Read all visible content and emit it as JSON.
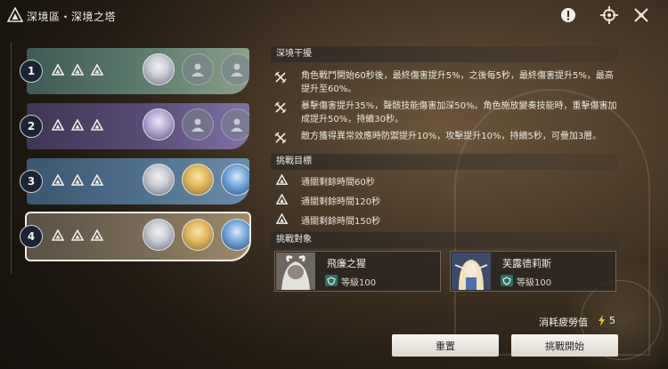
{
  "header": {
    "title": "深境區・深境之塔"
  },
  "stages": [
    {
      "number": "1",
      "avatars": [
        "white",
        "empty",
        "empty"
      ],
      "selected": false
    },
    {
      "number": "2",
      "avatars": [
        "lav",
        "empty",
        "empty"
      ],
      "selected": false
    },
    {
      "number": "3",
      "avatars": [
        "white",
        "blond",
        "blue"
      ],
      "selected": false
    },
    {
      "number": "4",
      "avatars": [
        "white",
        "blond",
        "blue"
      ],
      "selected": true
    }
  ],
  "interference": {
    "heading": "深境干擾",
    "effects": [
      {
        "text": "角色戰鬥開始60秒後，最終傷害提升5%，之後每5秒，最終傷害提升5%，最高提升至60%。"
      },
      {
        "text": "暴擊傷害提升35%，聲骸技能傷害加深50%。角色施放變奏技能時，重擊傷害加成提升50%，持續30秒。"
      },
      {
        "text": "敵方獲得異常效應時防禦提升10%，攻擊提升10%，持續5秒，可疊加3層。"
      }
    ]
  },
  "goals": {
    "heading": "挑戰目標",
    "items": [
      {
        "text": "通關剩餘時間60秒"
      },
      {
        "text": "通關剩餘時間120秒"
      },
      {
        "text": "通關剩餘時間150秒"
      }
    ]
  },
  "targets": {
    "heading": "挑戰對象",
    "enemies": [
      {
        "name": "飛廉之猩",
        "level": "等級100"
      },
      {
        "name": "芙露德莉斯",
        "level": "等級100"
      }
    ]
  },
  "fatigue": {
    "label": "消耗疲勞值",
    "value": "5"
  },
  "buttons": {
    "reset": "重置",
    "start": "挑戰開始"
  },
  "colors": {
    "accent": "#f4efe2",
    "level_badge": "#2d6f63",
    "bolt": "#f2c230"
  }
}
